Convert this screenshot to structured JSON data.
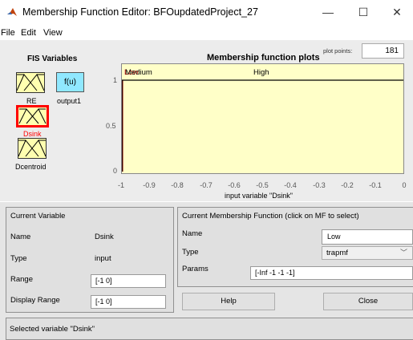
{
  "window": {
    "title": "Membership Function Editor: BFOupdatedProject_27",
    "min_glyph": "—",
    "max_glyph": "☐",
    "close_glyph": "✕"
  },
  "menu": {
    "file": "File",
    "edit": "Edit",
    "view": "View"
  },
  "fis": {
    "heading": "FIS Variables",
    "inputs": [
      "RE",
      "Dsink",
      "Dcentroid"
    ],
    "output_name": "output1",
    "output_symbol": "f(u)",
    "selected": "Dsink",
    "box_color": "#ffffb0",
    "output_color": "#90e8ff",
    "selected_color": "#ff0000"
  },
  "plot": {
    "title": "Membership function plots",
    "plot_points_label": "plot points:",
    "plot_points": "181",
    "xlabel": "input variable \"Dsink\"",
    "mf_labels": {
      "low": "Low",
      "medium": "Medium",
      "high": "High"
    },
    "bg_color": "#ffffc8",
    "line_color": "#000000",
    "selected_line_color": "#8b0000"
  },
  "chart_data": {
    "type": "line",
    "title": "Membership function plots",
    "xlabel": "input variable \"Dsink\"",
    "ylabel": "",
    "xlim": [
      -1,
      0
    ],
    "ylim": [
      0,
      1
    ],
    "xticks": [
      "-1",
      "-0.9",
      "-0.8",
      "-0.7",
      "-0.6",
      "-0.5",
      "-0.4",
      "-0.3",
      "-0.2",
      "-0.1",
      "0"
    ],
    "yticks": [
      "0",
      "0.5",
      "1"
    ],
    "series": [
      {
        "name": "Low",
        "x": [
          -1,
          -1,
          -1
        ],
        "y": [
          1,
          1,
          0
        ],
        "color": "#8b0000"
      },
      {
        "name": "Medium",
        "x": [
          -1,
          -1
        ],
        "y": [
          0,
          1
        ],
        "color": "#000000"
      },
      {
        "name": "High",
        "x": [
          -1,
          -1,
          0
        ],
        "y": [
          0,
          1,
          1
        ],
        "color": "#000000"
      }
    ]
  },
  "current_variable": {
    "heading": "Current Variable",
    "name_label": "Name",
    "name_value": "Dsink",
    "type_label": "Type",
    "type_value": "input",
    "range_label": "Range",
    "range_value": "[-1 0]",
    "display_range_label": "Display Range",
    "display_range_value": "[-1 0]"
  },
  "current_mf": {
    "heading": "Current Membership Function (click on MF to select)",
    "name_label": "Name",
    "name_value": "Low",
    "type_label": "Type",
    "type_value": "trapmf",
    "params_label": "Params",
    "params_value": "[-Inf -1 -1 -1]"
  },
  "buttons": {
    "help": "Help",
    "close": "Close"
  },
  "status": "Selected variable \"Dsink\""
}
